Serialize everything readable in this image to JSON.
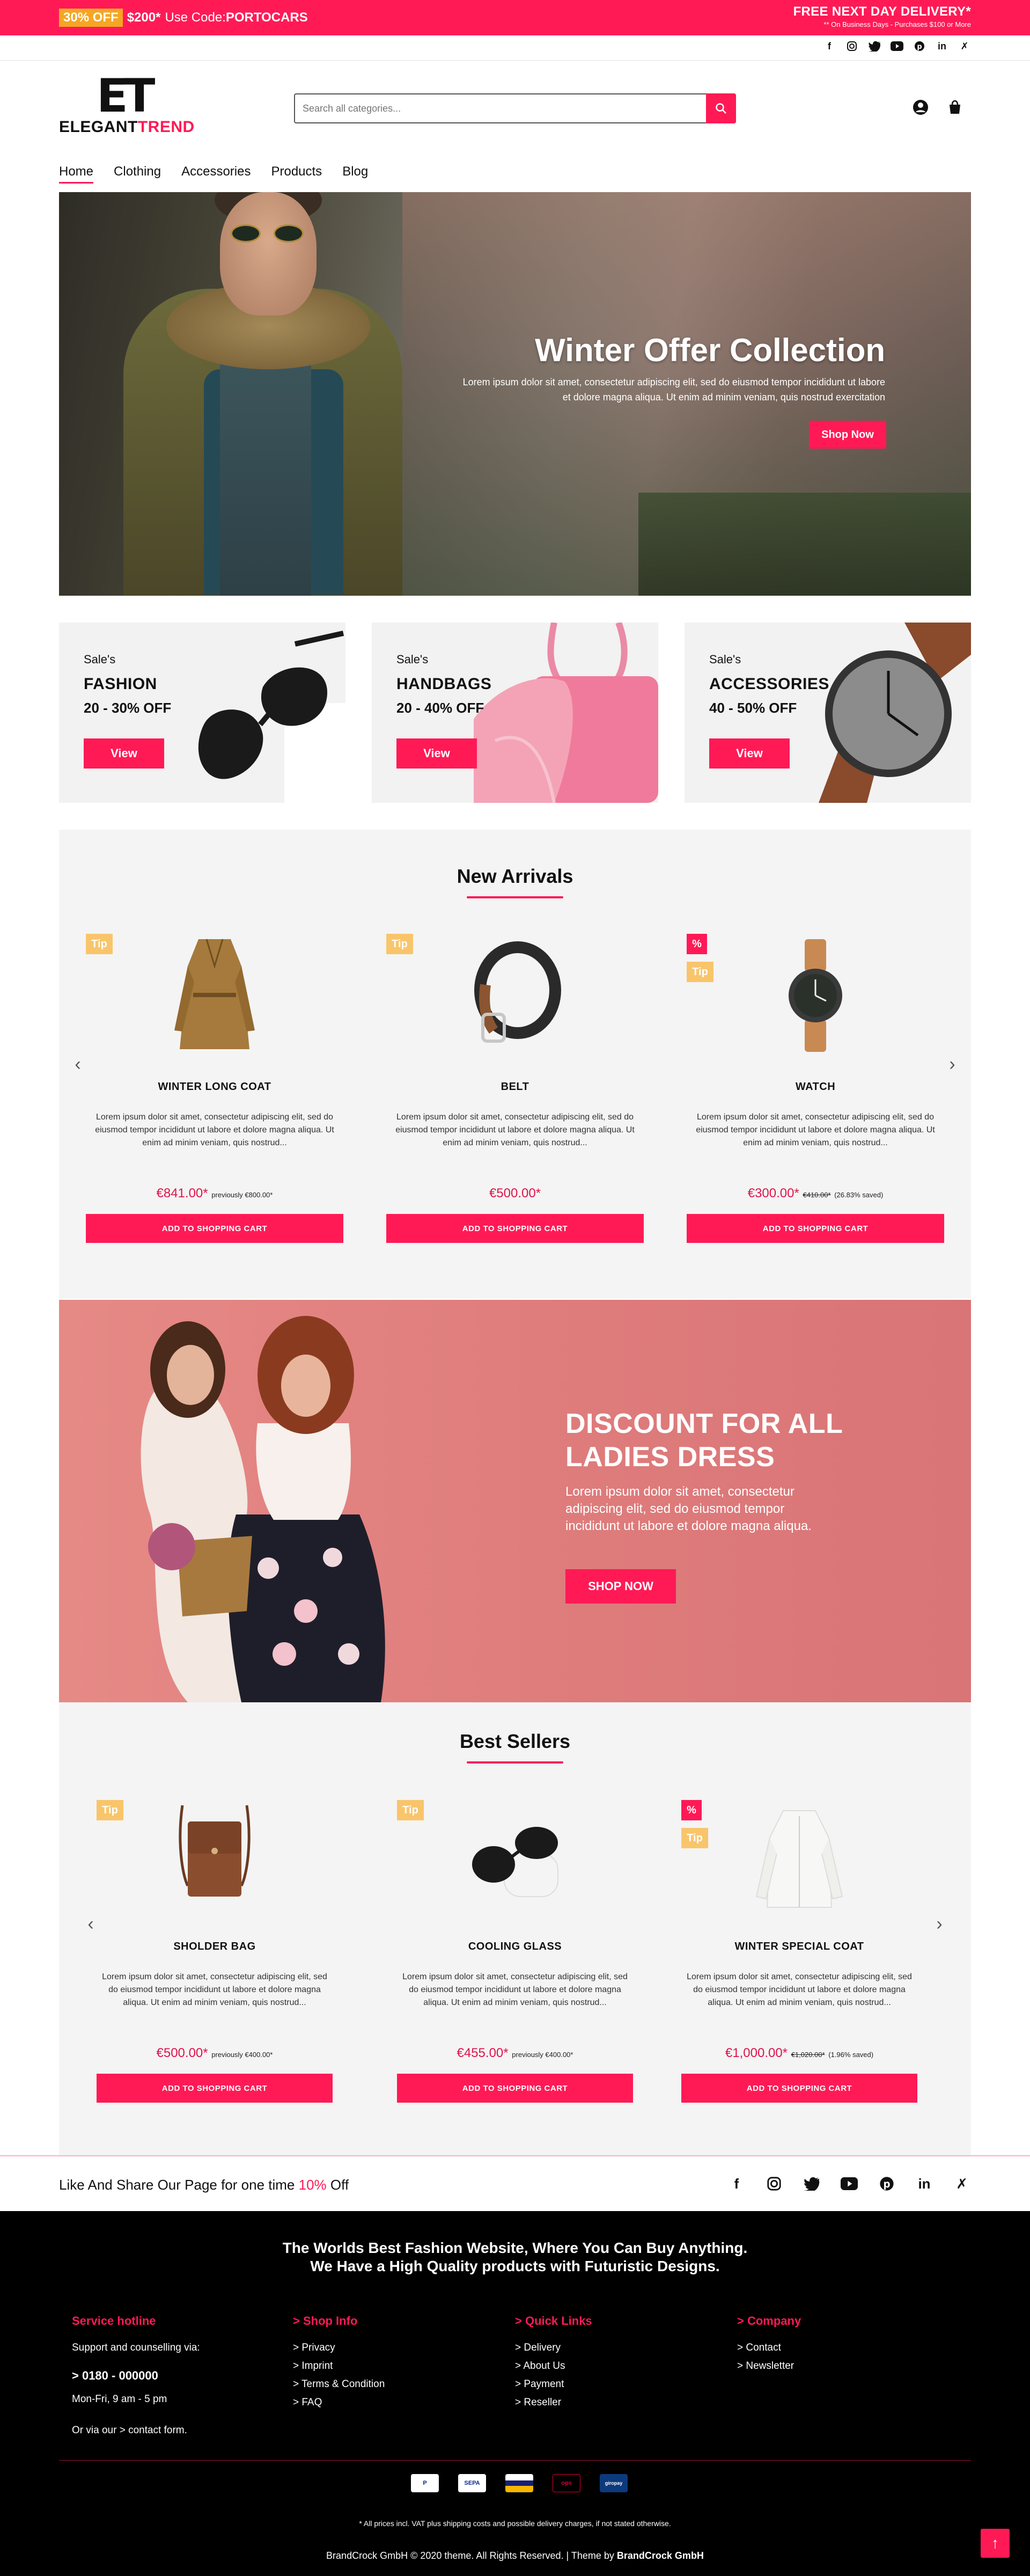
{
  "topbar": {
    "discount_badge": "30% OFF",
    "amount": "$200*",
    "code_prefix": "Use Code:",
    "code": "PORTOCARS",
    "delivery_title": "FREE NEXT DAY DELIVERY*",
    "delivery_sub": "** On Business Days - Purchases $100 or More"
  },
  "social_icons": [
    "facebook-icon",
    "instagram-icon",
    "twitter-icon",
    "youtube-icon",
    "pinterest-icon",
    "linkedin-icon",
    "x-icon"
  ],
  "logo": {
    "mark": "ET",
    "word_dark": "ELEGANT",
    "word_accent": "TREND"
  },
  "search": {
    "placeholder": "Search all categories..."
  },
  "nav": [
    "Home",
    "Clothing",
    "Accessories",
    "Products",
    "Blog"
  ],
  "hero": {
    "title": "Winter Offer Collection",
    "subtitle": "Lorem ipsum dolor sit amet, consectetur adipiscing elit, sed do eiusmod tempor incididunt ut labore et dolore magna aliqua. Ut enim ad minim veniam, quis nostrud exercitation",
    "cta": "Shop Now"
  },
  "categories": [
    {
      "sale": "Sale's",
      "name": "FASHION",
      "off": "20 - 30% OFF",
      "button": "View"
    },
    {
      "sale": "Sale's",
      "name": "HANDBAGS",
      "off": "20 - 40% OFF",
      "button": "View"
    },
    {
      "sale": "Sale's",
      "name": "ACCESSORIES",
      "off": "40 - 50% OFF",
      "button": "View"
    }
  ],
  "new_arrivals": {
    "title": "New Arrivals",
    "products": [
      {
        "tip": "Tip",
        "pct": "",
        "name": "WINTER LONG COAT",
        "desc": "Lorem ipsum dolor sit amet, consectetur adipiscing elit, sed do eiusmod tempor incididunt ut labore et dolore magna aliqua. Ut enim ad minim veniam, quis nostrud...",
        "price": "€841.00*",
        "prev": "previously €800.00*",
        "old": "",
        "saved": "",
        "cart": "ADD TO SHOPPING CART"
      },
      {
        "tip": "Tip",
        "pct": "",
        "name": "BELT",
        "desc": "Lorem ipsum dolor sit amet, consectetur adipiscing elit, sed do eiusmod tempor incididunt ut labore et dolore magna aliqua. Ut enim ad minim veniam, quis nostrud...",
        "price": "€500.00*",
        "prev": "",
        "old": "",
        "saved": "",
        "cart": "ADD TO SHOPPING CART"
      },
      {
        "tip": "Tip",
        "pct": "%",
        "name": "WATCH",
        "desc": "Lorem ipsum dolor sit amet, consectetur adipiscing elit, sed do eiusmod tempor incididunt ut labore et dolore magna aliqua. Ut enim ad minim veniam, quis nostrud...",
        "price": "€300.00*",
        "prev": "",
        "old": "€410.00*",
        "saved": "(26.83% saved)",
        "cart": "ADD TO SHOPPING CART"
      }
    ]
  },
  "discount": {
    "title_line1": "DISCOUNT FOR ALL",
    "title_line2": "LADIES DRESS",
    "text": "Lorem ipsum dolor sit amet, consectetur adipiscing elit, sed do eiusmod tempor incididunt ut labore et dolore magna aliqua.",
    "button": "SHOP NOW"
  },
  "best_sellers": {
    "title": "Best Sellers",
    "products": [
      {
        "tip": "Tip",
        "pct": "",
        "name": "SHOLDER BAG",
        "desc": "Lorem ipsum dolor sit amet, consectetur adipiscing elit, sed do eiusmod tempor incididunt ut labore et dolore magna aliqua. Ut enim ad minim veniam, quis nostrud...",
        "price": "€500.00*",
        "prev": "previously €400.00*",
        "old": "",
        "saved": "",
        "cart": "ADD TO SHOPPING CART"
      },
      {
        "tip": "Tip",
        "pct": "",
        "name": "COOLING GLASS",
        "desc": "Lorem ipsum dolor sit amet, consectetur adipiscing elit, sed do eiusmod tempor incididunt ut labore et dolore magna aliqua. Ut enim ad minim veniam, quis nostrud...",
        "price": "€455.00*",
        "prev": "previously €400.00*",
        "old": "",
        "saved": "",
        "cart": "ADD TO SHOPPING CART"
      },
      {
        "tip": "Tip",
        "pct": "%",
        "name": "WINTER SPECIAL COAT",
        "desc": "Lorem ipsum dolor sit amet, consectetur adipiscing elit, sed do eiusmod tempor incididunt ut labore et dolore magna aliqua. Ut enim ad minim veniam, quis nostrud...",
        "price": "€1,000.00*",
        "prev": "",
        "old": "€1,020.00*",
        "saved": "(1.96% saved)",
        "cart": "ADD TO SHOPPING CART"
      }
    ]
  },
  "share": {
    "text_before": "Like And Share Our Page for one time",
    "pct": "10%",
    "text_after": "Off"
  },
  "footer": {
    "tagline_1": "The Worlds Best Fashion Website, Where You Can Buy Anything.",
    "tagline_2": "We Have a High Quality products with Futuristic Designs.",
    "service": {
      "head": "Service hotline",
      "support": "Support and counselling via:",
      "phone": "> 0180 - 000000",
      "hours": "Mon-Fri, 9 am - 5 pm",
      "contact": "Or via our >  contact form."
    },
    "shop_info": {
      "head": ">  Shop Info",
      "items": [
        ">  Privacy",
        ">  Imprint",
        ">  Terms & Condition",
        ">  FAQ"
      ]
    },
    "quick_links": {
      "head": ">  Quick Links",
      "items": [
        ">  Delivery",
        ">  About Us",
        ">  Payment",
        ">  Reseller"
      ]
    },
    "company": {
      "head": ">  Company",
      "items": [
        ">  Contact",
        ">  Newsletter"
      ]
    },
    "payments": [
      "P",
      "SEPA",
      "VISA",
      "ops",
      "giropay"
    ],
    "note": "* All prices incl. VAT plus shipping costs and possible delivery charges, if not stated otherwise.",
    "copyright": "BrandCrock GmbH © 2020 theme. All Rights Reserved. | Theme by",
    "copyright_brand": "BrandCrock GmbH"
  },
  "colors": {
    "accent": "#ff1a56",
    "tip": "#f9c56b",
    "footer_bg": "#000000",
    "section_bg": "#f4f4f4"
  }
}
